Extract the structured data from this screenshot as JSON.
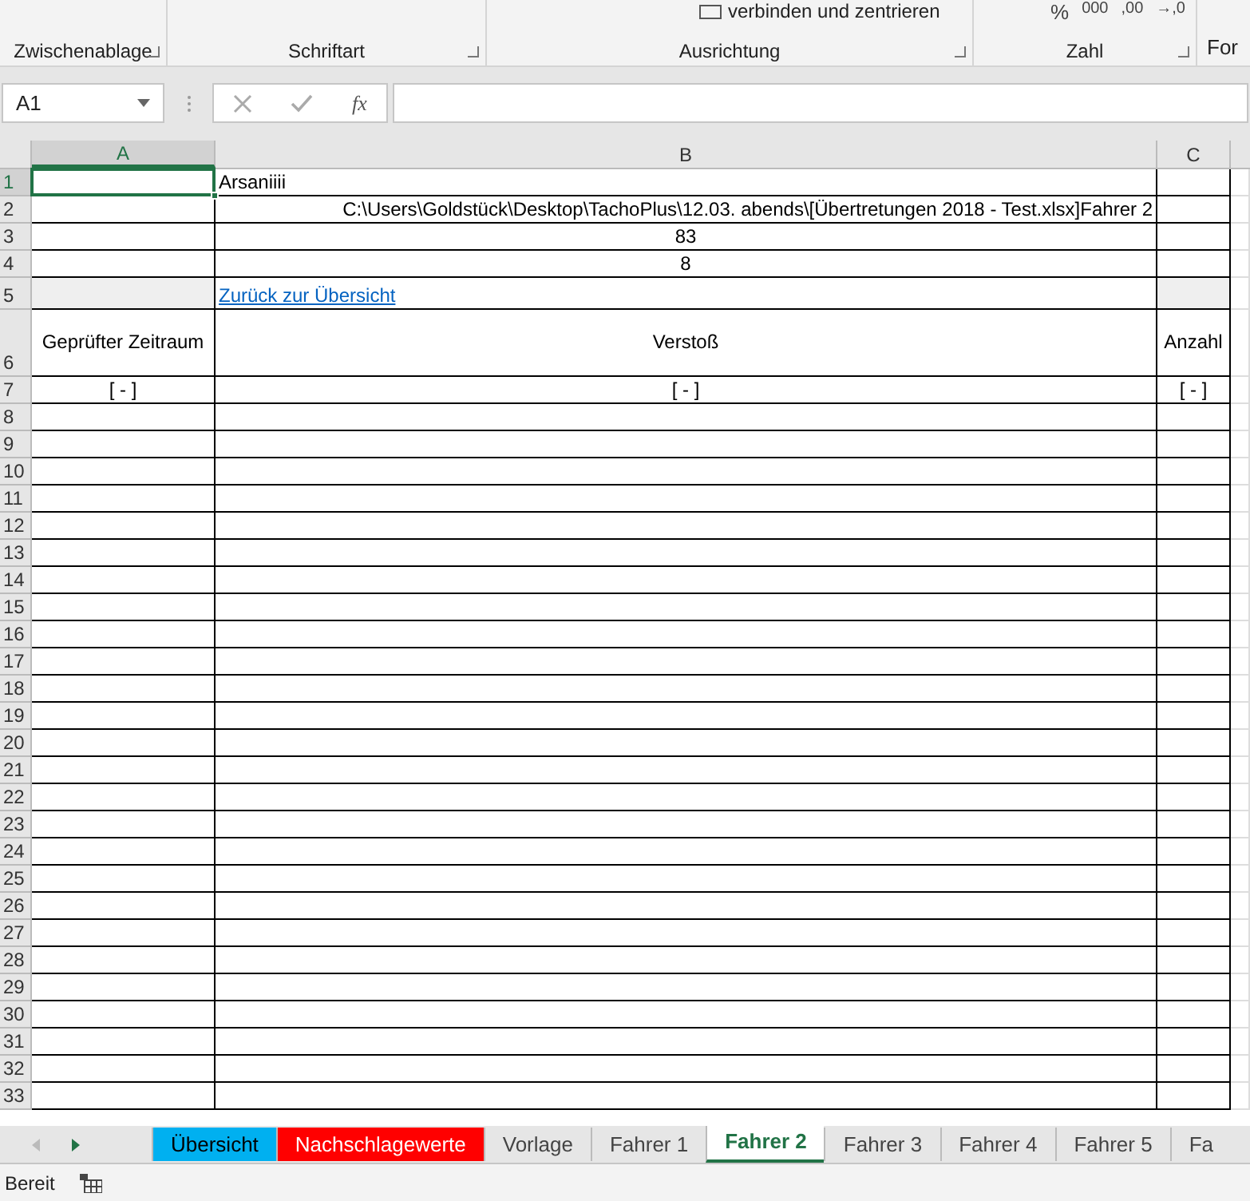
{
  "ribbon": {
    "groups": [
      {
        "label": "Zwischenablage"
      },
      {
        "label": "Schriftart"
      },
      {
        "label": "Ausrichtung",
        "button": "verbinden und zentrieren"
      },
      {
        "label": "Zahl",
        "symbols": [
          "%",
          "000",
          ",00",
          "→,0"
        ]
      }
    ],
    "cut_label": "For"
  },
  "formula_bar": {
    "name_box": "A1",
    "fx": "fx"
  },
  "columns": [
    {
      "label": "A",
      "selected": true
    },
    {
      "label": "B",
      "selected": false
    },
    {
      "label": "C",
      "selected": false
    }
  ],
  "rows": [
    {
      "number": "1",
      "selected": true,
      "b": "Arsaniiii",
      "kind": "title"
    },
    {
      "number": "2",
      "selected": false,
      "b": "C:\\Users\\Goldstück\\Desktop\\TachoPlus\\12.03. abends\\[Übertretungen 2018 - Test.xlsx]Fahrer 2",
      "kind": "path"
    },
    {
      "number": "3",
      "selected": false,
      "b": "83",
      "kind": "value"
    },
    {
      "number": "4",
      "selected": false,
      "b": "8",
      "kind": "value"
    },
    {
      "number": "5",
      "selected": false,
      "b": "Zurück zur Übersicht",
      "kind": "link",
      "shaded": true
    },
    {
      "number": "6",
      "selected": false,
      "kind": "tall",
      "a": "Geprüfter Zeitraum",
      "b": "Verstoß",
      "c": "Anzahl"
    },
    {
      "number": "7",
      "selected": false,
      "a": "[ - ]",
      "b": "[ - ]",
      "c": "[ - ]"
    },
    {
      "number": "8",
      "selected": false
    },
    {
      "number": "9",
      "selected": false
    },
    {
      "number": "10",
      "selected": false
    },
    {
      "number": "11",
      "selected": false
    },
    {
      "number": "12",
      "selected": false
    },
    {
      "number": "13",
      "selected": false
    },
    {
      "number": "14",
      "selected": false
    },
    {
      "number": "15",
      "selected": false
    },
    {
      "number": "16",
      "selected": false
    },
    {
      "number": "17",
      "selected": false
    },
    {
      "number": "18",
      "selected": false
    },
    {
      "number": "19",
      "selected": false
    },
    {
      "number": "20",
      "selected": false
    },
    {
      "number": "21",
      "selected": false
    },
    {
      "number": "22",
      "selected": false
    },
    {
      "number": "23",
      "selected": false
    },
    {
      "number": "24",
      "selected": false
    },
    {
      "number": "25",
      "selected": false
    },
    {
      "number": "26",
      "selected": false
    },
    {
      "number": "27",
      "selected": false
    },
    {
      "number": "28",
      "selected": false
    },
    {
      "number": "29",
      "selected": false
    },
    {
      "number": "30",
      "selected": false
    },
    {
      "number": "31",
      "selected": false
    },
    {
      "number": "32",
      "selected": false
    },
    {
      "number": "33",
      "selected": false
    }
  ],
  "sheet_tabs": [
    {
      "label": "Übersicht",
      "selected": false,
      "color": "#00b0f0"
    },
    {
      "label": "Nachschlagewerte",
      "selected": false,
      "color": "#ff0000"
    },
    {
      "label": "Vorlage",
      "selected": false
    },
    {
      "label": "Fahrer 1",
      "selected": false
    },
    {
      "label": "Fahrer 2",
      "selected": true
    },
    {
      "label": "Fahrer 3",
      "selected": false
    },
    {
      "label": "Fahrer 4",
      "selected": false
    },
    {
      "label": "Fahrer 5",
      "selected": false
    },
    {
      "label": "Fa",
      "selected": false
    }
  ],
  "status_bar": {
    "text": "Bereit"
  }
}
